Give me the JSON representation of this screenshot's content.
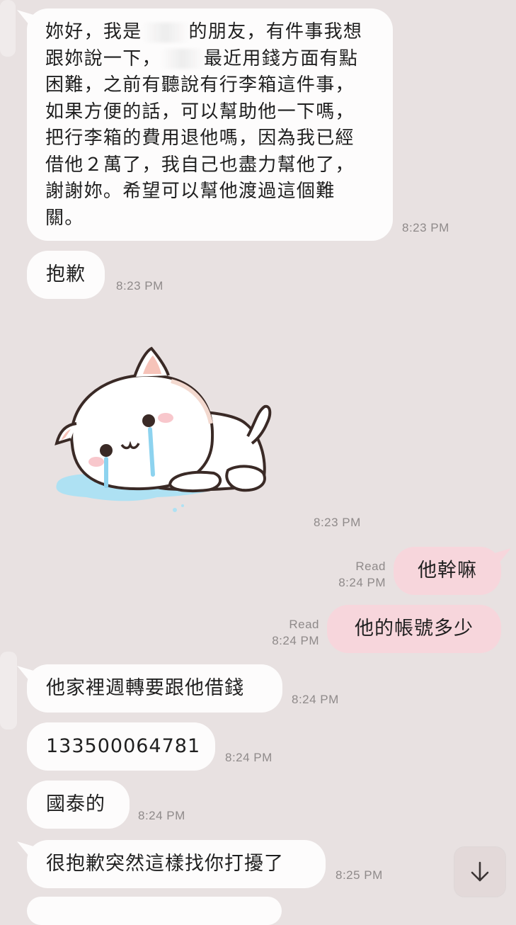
{
  "messages": {
    "m1": {
      "part1": "妳好，我是",
      "part2": "的朋友，有件事我想跟妳說一下，",
      "part3": "最近用錢方面有點困難，之前有聽說有行李箱這件事，如果方便的話，可以幫助他一下嗎，把行李箱的費用退他嗎，因為我已經借他２萬了，我自己也盡力幫他了，謝謝妳。希望可以幫他渡過這個難關。",
      "time": "8:23 PM"
    },
    "m2": {
      "text": "抱歉",
      "time": "8:23 PM"
    },
    "sticker": {
      "time": "8:23 PM",
      "icon": "crying-cat-sticker"
    },
    "m3": {
      "text": "他幹嘛",
      "read": "Read",
      "time": "8:24 PM"
    },
    "m4": {
      "text": "他的帳號多少",
      "read": "Read",
      "time": "8:24 PM"
    },
    "m5": {
      "text": "他家裡週轉要跟他借錢",
      "time": "8:24 PM"
    },
    "m6": {
      "text": "133500064781",
      "time": "8:24 PM"
    },
    "m7": {
      "text": "國泰的",
      "time": "8:24 PM"
    },
    "m8": {
      "text": "很抱歉突然這樣找你打擾了",
      "time": "8:25 PM"
    }
  },
  "colors": {
    "background": "#e8e1e1",
    "incoming_bubble": "#fdfcfc",
    "outgoing_bubble": "#f7d6dc",
    "timestamp": "#8f8a8a"
  },
  "controls": {
    "scroll_down_icon": "arrow-down-icon"
  }
}
